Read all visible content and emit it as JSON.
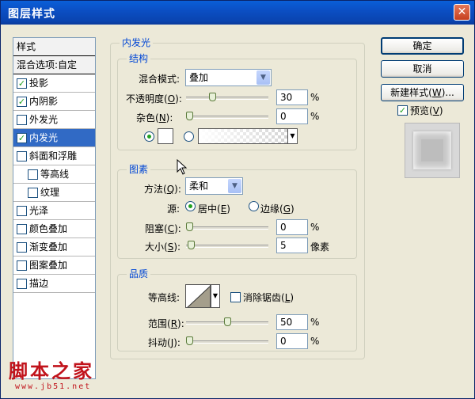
{
  "window": {
    "title": "图层样式",
    "close_glyph": "✕"
  },
  "style_list": {
    "header": "样式",
    "blend_options": "混合选项:自定",
    "items": [
      {
        "label": "投影",
        "checked": true
      },
      {
        "label": "内阴影",
        "checked": true
      },
      {
        "label": "外发光",
        "checked": false
      },
      {
        "label": "内发光",
        "checked": true,
        "selected": true
      },
      {
        "label": "斜面和浮雕",
        "checked": false
      },
      {
        "label": "等高线",
        "checked": false,
        "sub": true
      },
      {
        "label": "纹理",
        "checked": false,
        "sub": true
      },
      {
        "label": "光泽",
        "checked": false
      },
      {
        "label": "颜色叠加",
        "checked": false
      },
      {
        "label": "渐变叠加",
        "checked": false
      },
      {
        "label": "图案叠加",
        "checked": false
      },
      {
        "label": "描边",
        "checked": false
      }
    ],
    "check_glyph": "✓"
  },
  "panel": {
    "title": "内发光",
    "structure": {
      "title": "结构",
      "blend_mode_label": "混合模式:",
      "blend_mode_value": "叠加",
      "opacity_label": "不透明度(",
      "opacity_key": "O",
      "opacity_value": "30",
      "opacity_fraction": 0.3,
      "noise_label": "杂色(",
      "noise_key": "N",
      "noise_value": "0",
      "noise_fraction": 0.0,
      "percent": "%"
    },
    "elements": {
      "title": "图素",
      "technique_label": "方法(",
      "technique_key": "Q",
      "technique_value": "柔和",
      "source_label": "源:",
      "source_center": "居中(",
      "source_center_key": "E",
      "source_edge": "边缘(",
      "source_edge_key": "G",
      "choke_label": "阻塞(",
      "choke_key": "C",
      "choke_value": "0",
      "choke_fraction": 0.0,
      "size_label": "大小(",
      "size_key": "S",
      "size_value": "5",
      "size_fraction": 0.02,
      "percent": "%",
      "px_unit": "像素"
    },
    "quality": {
      "title": "品质",
      "contour_label": "等高线:",
      "anti_alias_label": "消除锯齿(",
      "anti_alias_key": "L",
      "anti_alias_checked": false,
      "range_label": "范围(",
      "range_key": "R",
      "range_value": "50",
      "range_fraction": 0.5,
      "jitter_label": "抖动(",
      "jitter_key": "J",
      "jitter_value": "0",
      "jitter_fraction": 0.0,
      "percent": "%"
    }
  },
  "buttons": {
    "ok": "确定",
    "cancel": "取消",
    "new_style": "新建样式(",
    "new_style_key": "W",
    "new_style_suffix": ")...",
    "preview_label": "预览(",
    "preview_key": "V",
    "preview_checked": true
  },
  "watermark": {
    "main": "脚本之家",
    "url": "www.jb51.net"
  },
  "colors": {
    "title_bar": "#0b4fc4",
    "selection": "#316ac5",
    "group_label": "#0046d5",
    "watermark": "#c1131b"
  }
}
